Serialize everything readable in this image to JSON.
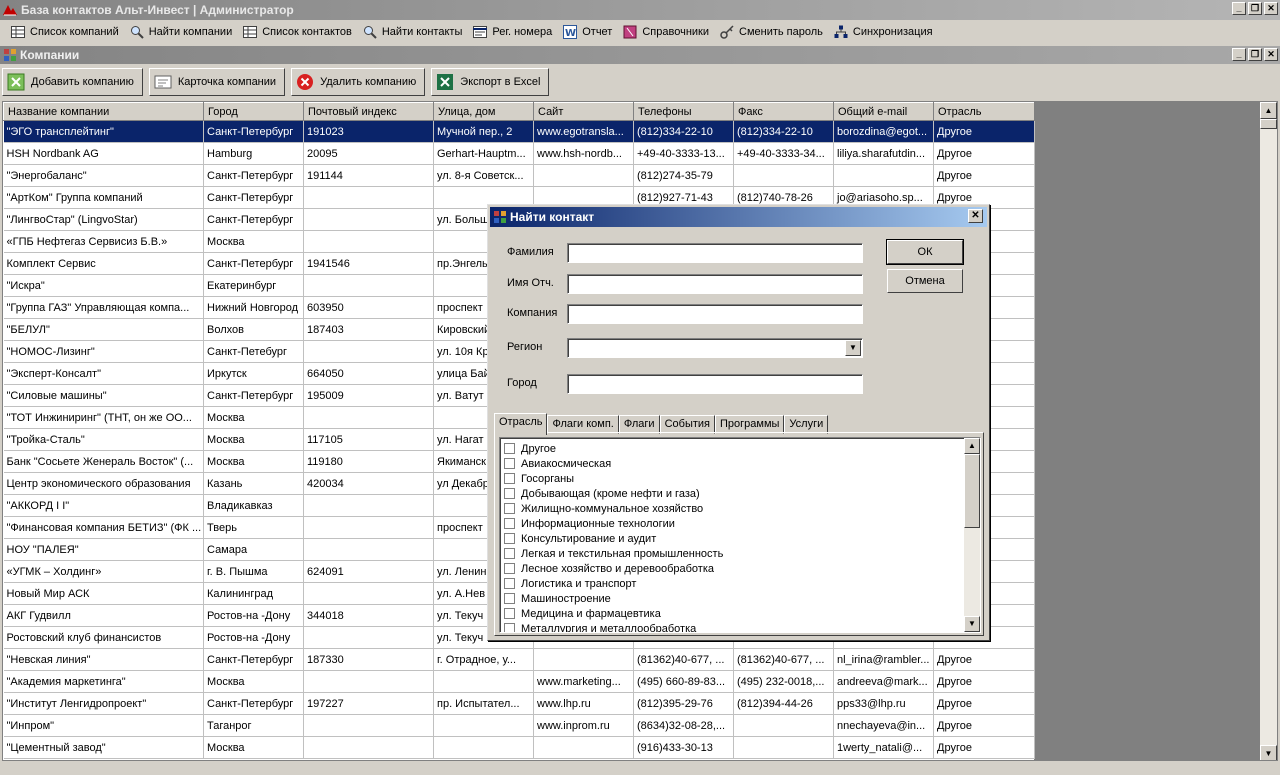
{
  "window": {
    "title": "База контактов Альт-Инвест | Администратор"
  },
  "menu": {
    "items": [
      {
        "label": "Список компаний",
        "icon": "grid-icon"
      },
      {
        "label": "Найти компании",
        "icon": "magnifier-icon"
      },
      {
        "label": "Список контактов",
        "icon": "grid-icon"
      },
      {
        "label": "Найти контакты",
        "icon": "magnifier-icon"
      },
      {
        "label": "Рег. номера",
        "icon": "register-icon"
      },
      {
        "label": "Отчет",
        "icon": "word-doc-icon"
      },
      {
        "label": "Справочники",
        "icon": "book-icon"
      },
      {
        "label": "Сменить пароль",
        "icon": "key-icon"
      },
      {
        "label": "Синхронизация",
        "icon": "sync-icon"
      }
    ]
  },
  "child_window": {
    "title": "Компании"
  },
  "toolbar": {
    "add": "Добавить компанию",
    "card": "Карточка компании",
    "delete": "Удалить компанию",
    "export": "Экспорт в Excel"
  },
  "grid": {
    "columns": [
      "Название компании",
      "Город",
      "Почтовый индекс",
      "Улица, дом",
      "Сайт",
      "Телефоны",
      "Факс",
      "Общий e-mail",
      "Отрасль"
    ],
    "rows": [
      [
        "\"ЭГО трансплейтинг\"",
        "Санкт-Петербург",
        "191023",
        "Мучной пер., 2",
        "www.egotransla...",
        "(812)334-22-10",
        "(812)334-22-10",
        "borozdina@egot...",
        "Другое"
      ],
      [
        "HSH Nordbank AG",
        "Hamburg",
        "20095",
        "Gerhart-Hauptm...",
        "www.hsh-nordb...",
        "+49-40-3333-13...",
        "+49-40-3333-34...",
        "liliya.sharafutdin...",
        "Другое"
      ],
      [
        "\"Энергобаланс\"",
        "Санкт-Петербург",
        "191144",
        "ул. 8-я Советск...",
        "",
        "(812)274-35-79",
        "",
        "",
        "Другое"
      ],
      [
        "\"АртКом\" Группа компаний",
        "Санкт-Петербург",
        "",
        "",
        "",
        "(812)927-71-43",
        "(812)740-78-26",
        "jo@ariasoho.sp...",
        "Другое"
      ],
      [
        "\"ЛингвоСтар\" (LingvoStar)",
        "Санкт-Петербург",
        "",
        "ул. Больш",
        "",
        "",
        "",
        "",
        ""
      ],
      [
        "«ГПБ Нефтегаз Сервисиз Б.В.»",
        "Москва",
        "",
        "",
        "",
        "",
        "",
        "",
        ""
      ],
      [
        "Комплект Сервис",
        "Санкт-Петербург",
        "1941546",
        "пр.Энгель",
        "",
        "",
        "",
        "",
        ""
      ],
      [
        "\"Искра\"",
        "Екатеринбург",
        "",
        "",
        "",
        "",
        "",
        "",
        ""
      ],
      [
        "\"Группа ГАЗ\" Управляющая компа...",
        "Нижний Новгород",
        "603950",
        "проспект",
        "",
        "",
        "",
        "",
        ""
      ],
      [
        "\"БЕЛУЛ\"",
        "Волхов",
        "187403",
        "Кировский",
        "",
        "",
        "",
        "",
        ""
      ],
      [
        "\"НОМОС-Лизинг\"",
        "Санкт-Петебург",
        "",
        "ул. 10я Кр",
        "",
        "",
        "",
        "",
        ""
      ],
      [
        "\"Эксперт-Консалт\"",
        "Иркутск",
        "664050",
        "улица Бай",
        "",
        "",
        "",
        "",
        ""
      ],
      [
        "\"Силовые машины\"",
        "Санкт-Петербург",
        "195009",
        "ул. Ватут",
        "",
        "",
        "",
        "",
        ""
      ],
      [
        "\"ТОТ Инжиниринг\" (ТНТ, он же ОО...",
        "Москва",
        "",
        "",
        "",
        "",
        "",
        "",
        ""
      ],
      [
        "\"Тройка-Сталь\"",
        "Москва",
        "117105",
        "ул. Нагат",
        "",
        "",
        "",
        "",
        ""
      ],
      [
        "Банк \"Сосьете Женераль Восток\" (...",
        "Москва",
        "119180",
        "Якиманск",
        "",
        "",
        "",
        "",
        ""
      ],
      [
        "Центр экономического образования",
        "Казань",
        "420034",
        "ул Декабр",
        "",
        "",
        "",
        "",
        ""
      ],
      [
        "\"АККОРД I I\"",
        "Владикавказ",
        "",
        "",
        "",
        "",
        "",
        "",
        ""
      ],
      [
        "\"Финансовая компания БЕТИЗ\" (ФК ...",
        "Тверь",
        "",
        "проспект",
        "",
        "",
        "",
        "",
        ""
      ],
      [
        "НОУ \"ПАЛЕЯ\"",
        "Самара",
        "",
        "",
        "",
        "",
        "",
        "",
        ""
      ],
      [
        " «УГМК – Холдинг»",
        "г. В. Пышма",
        "624091",
        "ул. Ленин",
        "",
        "",
        "",
        "",
        ""
      ],
      [
        "Новый Мир  АСК",
        "Калининград",
        "",
        " ул. А.Нев",
        "",
        "",
        "",
        "",
        ""
      ],
      [
        "АКГ Гудвилл",
        "Ростов-на -Дону",
        "344018",
        "ул. Текуч",
        "",
        "",
        "",
        "",
        ""
      ],
      [
        "Ростовский  клуб финансистов",
        "Ростов-на -Дону",
        "",
        "ул. Текуч",
        "",
        "",
        "",
        "",
        ""
      ],
      [
        "\"Невская линия\"",
        "Санкт-Петербург",
        "187330",
        "г. Отрадное, у...",
        "",
        "(81362)40-677, ...",
        "(81362)40-677, ...",
        "nl_irina@rambler...",
        "Другое"
      ],
      [
        "\"Академия маркетинга\"",
        "Москва",
        "",
        "",
        "www.marketing...",
        "(495) 660-89-83...",
        "(495) 232-0018,...",
        "andreeva@mark...",
        "Другое"
      ],
      [
        "\"Институт Ленгидропроект\"",
        "Санкт-Петербург",
        "197227",
        "пр. Испытател...",
        "www.lhp.ru",
        "(812)395-29-76",
        "(812)394-44-26",
        "pps33@lhp.ru",
        "Другое"
      ],
      [
        "\"Инпром\"",
        "Таганрог",
        "",
        "",
        "www.inprom.ru",
        "(8634)32-08-28,...",
        "",
        "nnechayeva@in...",
        "Другое"
      ],
      [
        "\"Цементный завод\"",
        "Москва",
        "",
        "",
        "",
        "(916)433-30-13",
        "",
        "1werty_natali@...",
        "Другое"
      ]
    ]
  },
  "dialog": {
    "title": "Найти контакт",
    "fields": {
      "surname": {
        "label": "Фамилия",
        "value": ""
      },
      "name": {
        "label": "Имя Отч.",
        "value": ""
      },
      "company": {
        "label": "Компания",
        "value": ""
      },
      "region": {
        "label": "Регион",
        "value": ""
      },
      "city": {
        "label": "Город",
        "value": ""
      }
    },
    "ok": "ОК",
    "cancel": "Отмена",
    "tabs": [
      "Отрасль",
      "Флаги комп.",
      "Флаги",
      "События",
      "Программы",
      "Услуги"
    ],
    "industries": [
      "Другое",
      "Авиакосмическая",
      "Госорганы",
      "Добывающая (кроме нефти и газа)",
      "Жилищно-коммунальное хозяйство",
      "Информационные технологии",
      "Консультирование и аудит",
      "Легкая и текстильная промышленность",
      "Лесное хозяйство и деревообработка",
      "Логистика и транспорт",
      "Машиностроение",
      "Медицина и фармацевтика",
      "Металлургия и металлообработка"
    ]
  }
}
